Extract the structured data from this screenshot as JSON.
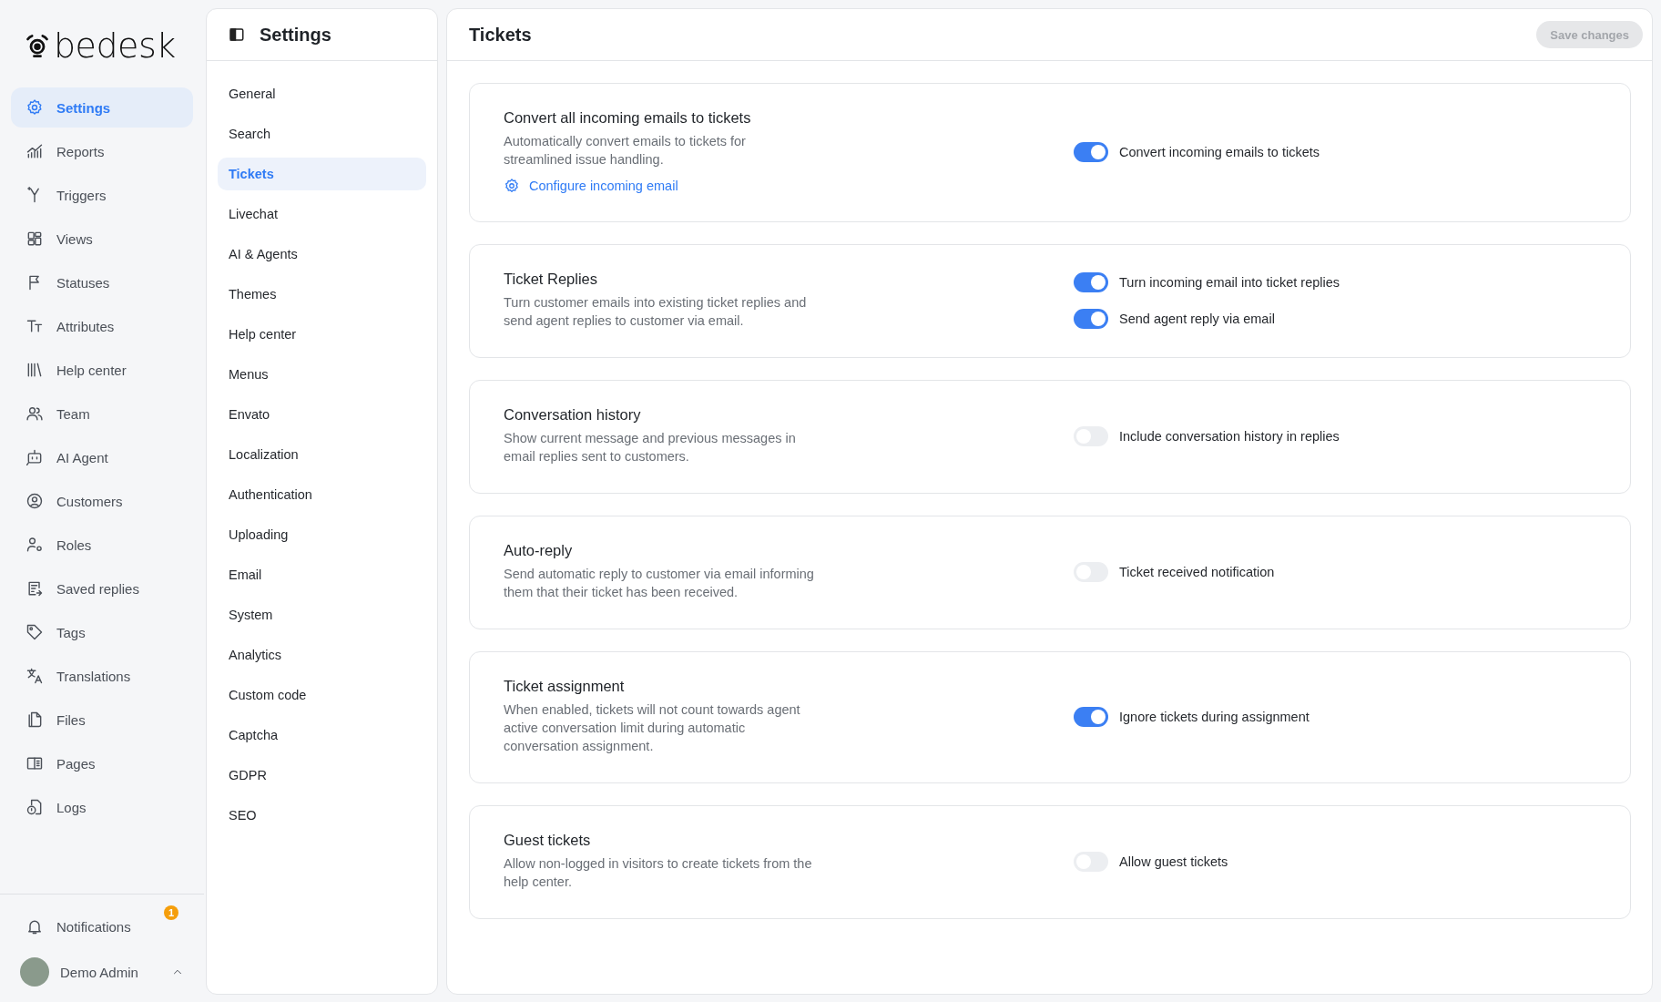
{
  "brand": {
    "name": "bedesk"
  },
  "sidebar": {
    "items": [
      {
        "label": "Settings",
        "selected": true
      },
      {
        "label": "Reports",
        "selected": false
      },
      {
        "label": "Triggers",
        "selected": false
      },
      {
        "label": "Views",
        "selected": false
      },
      {
        "label": "Statuses",
        "selected": false
      },
      {
        "label": "Attributes",
        "selected": false
      },
      {
        "label": "Help center",
        "selected": false
      },
      {
        "label": "Team",
        "selected": false
      },
      {
        "label": "AI Agent",
        "selected": false
      },
      {
        "label": "Customers",
        "selected": false
      },
      {
        "label": "Roles",
        "selected": false
      },
      {
        "label": "Saved replies",
        "selected": false
      },
      {
        "label": "Tags",
        "selected": false
      },
      {
        "label": "Translations",
        "selected": false
      },
      {
        "label": "Files",
        "selected": false
      },
      {
        "label": "Pages",
        "selected": false
      },
      {
        "label": "Logs",
        "selected": false
      }
    ],
    "notifications": {
      "label": "Notifications",
      "badge": "1"
    },
    "user": {
      "name": "Demo Admin"
    }
  },
  "settings_nav": {
    "title": "Settings",
    "items": [
      {
        "label": "General",
        "selected": false
      },
      {
        "label": "Search",
        "selected": false
      },
      {
        "label": "Tickets",
        "selected": true
      },
      {
        "label": "Livechat",
        "selected": false
      },
      {
        "label": "AI & Agents",
        "selected": false
      },
      {
        "label": "Themes",
        "selected": false
      },
      {
        "label": "Help center",
        "selected": false
      },
      {
        "label": "Menus",
        "selected": false
      },
      {
        "label": "Envato",
        "selected": false
      },
      {
        "label": "Localization",
        "selected": false
      },
      {
        "label": "Authentication",
        "selected": false
      },
      {
        "label": "Uploading",
        "selected": false
      },
      {
        "label": "Email",
        "selected": false
      },
      {
        "label": "System",
        "selected": false
      },
      {
        "label": "Analytics",
        "selected": false
      },
      {
        "label": "Custom code",
        "selected": false
      },
      {
        "label": "Captcha",
        "selected": false
      },
      {
        "label": "GDPR",
        "selected": false
      },
      {
        "label": "SEO",
        "selected": false
      }
    ]
  },
  "page": {
    "title": "Tickets",
    "save_button": {
      "label": "Save changes",
      "disabled": true
    }
  },
  "cards": [
    {
      "title": "Convert all incoming emails to tickets",
      "description": "Automatically convert emails to tickets for streamlined issue handling.",
      "link": "Configure incoming email",
      "toggles": [
        {
          "label": "Convert incoming emails to tickets",
          "on": true
        }
      ]
    },
    {
      "title": "Ticket Replies",
      "description": "Turn customer emails into existing ticket replies and send agent replies to customer via email.",
      "toggles": [
        {
          "label": "Turn incoming email into ticket replies",
          "on": true
        },
        {
          "label": "Send agent reply via email",
          "on": true
        }
      ]
    },
    {
      "title": "Conversation history",
      "description": "Show current message and previous messages in email replies sent to customers.",
      "toggles": [
        {
          "label": "Include conversation history in replies",
          "on": false
        }
      ]
    },
    {
      "title": "Auto-reply",
      "description": "Send automatic reply to customer via email informing them that their ticket has been received.",
      "toggles": [
        {
          "label": "Ticket received notification",
          "on": false
        }
      ]
    },
    {
      "title": "Ticket assignment",
      "description": "When enabled, tickets will not count towards agent active conversation limit during automatic conversation assignment.",
      "toggles": [
        {
          "label": "Ignore tickets during assignment",
          "on": true
        }
      ]
    },
    {
      "title": "Guest tickets",
      "description": "Allow non-logged in visitors to create tickets from the help center.",
      "toggles": [
        {
          "label": "Allow guest tickets",
          "on": false
        }
      ]
    }
  ]
}
